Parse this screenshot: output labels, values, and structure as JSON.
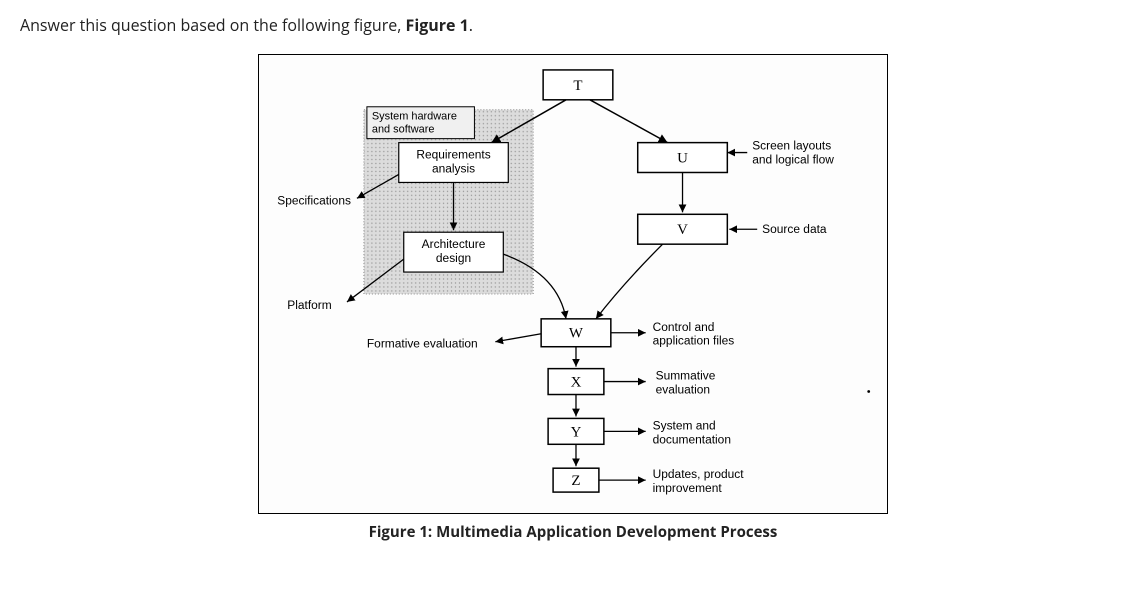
{
  "question_prefix": "Answer this question based on the following figure, ",
  "question_bold": "Figure 1",
  "question_suffix": ".",
  "caption": "Figure 1: Multimedia Application Development Process",
  "labels": {
    "T": "T",
    "U": "U",
    "V": "V",
    "W": "W",
    "X": "X",
    "Y": "Y",
    "Z": "Z",
    "sys_hw_sw": "System hardware\nand software",
    "req_analysis": "Requirements\nanalysis",
    "arch_design": "Architecture\ndesign",
    "specifications": "Specifications",
    "platform": "Platform",
    "formative_eval": "Formative evaluation",
    "screen_layouts": "Screen layouts\nand logical flow",
    "source_data": "Source data",
    "control_files": "Control and\napplication files",
    "summative_eval": "Summative\nevaluation",
    "sys_doc": "System and\ndocumentation",
    "updates": "Updates, product\nimprovement"
  }
}
